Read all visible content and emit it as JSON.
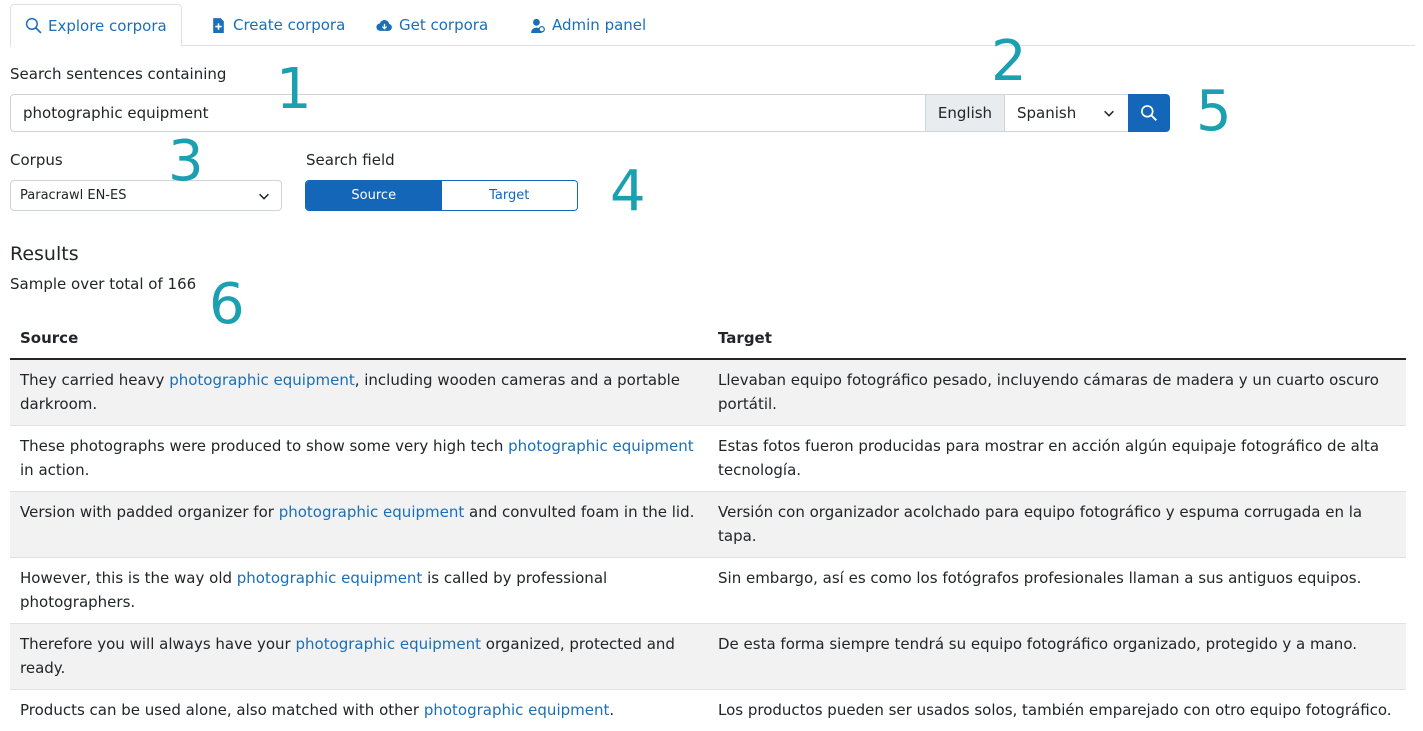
{
  "tabs": [
    {
      "label": "Explore corpora",
      "icon": "search-icon",
      "active": true
    },
    {
      "label": "Create corpora",
      "icon": "file-plus-icon",
      "active": false
    },
    {
      "label": "Get corpora",
      "icon": "cloud-download-icon",
      "active": false
    },
    {
      "label": "Admin panel",
      "icon": "admin-user-icon",
      "active": false
    }
  ],
  "search": {
    "label": "Search sentences containing",
    "value": "photographic equipment",
    "source_language": "English",
    "target_language": "Spanish"
  },
  "corpus": {
    "label": "Corpus",
    "selected": "Paracrawl EN-ES"
  },
  "search_field": {
    "label": "Search field",
    "options": [
      "Source",
      "Target"
    ],
    "selected": "Source"
  },
  "annotations": [
    "1",
    "2",
    "3",
    "4",
    "5",
    "6"
  ],
  "results": {
    "title": "Results",
    "subtitle": "Sample over total of 166",
    "headers": [
      "Source",
      "Target"
    ],
    "highlight": "photographic equipment",
    "rows": [
      {
        "source_before": "They carried heavy ",
        "source_after": ", including wooden cameras and a portable darkroom.",
        "target": "Llevaban equipo fotográfico pesado, incluyendo cámaras de madera y un cuarto oscuro portátil."
      },
      {
        "source_before": "These photographs were produced to show some very high tech ",
        "source_after": " in action.",
        "target": "Estas fotos fueron producidas para mostrar en acción algún equipaje fotográfico de alta tecnología."
      },
      {
        "source_before": "Version with padded organizer for ",
        "source_after": " and convulted foam in the lid.",
        "target": "Versión con organizador acolchado para equipo fotográfico y espuma corrugada en la tapa."
      },
      {
        "source_before": "However, this is the way old ",
        "source_after": " is called by professional photographers.",
        "target": "Sin embargo, así es como los fotógrafos profesionales llaman a sus antiguos equipos."
      },
      {
        "source_before": "Therefore you will always have your ",
        "source_after": " organized, protected and ready.",
        "target": "De esta forma siempre tendrá su equipo fotográfico organizado, protegido y a mano."
      },
      {
        "source_before": "Products can be used alone, also matched with other ",
        "source_after": ".",
        "target": "Los productos pueden ser usados solos, también emparejado con otro equipo fotográfico."
      }
    ]
  },
  "colors": {
    "accent": "#1466b8",
    "annotation": "#1aa0b0",
    "row_stripe": "#f2f2f2"
  }
}
